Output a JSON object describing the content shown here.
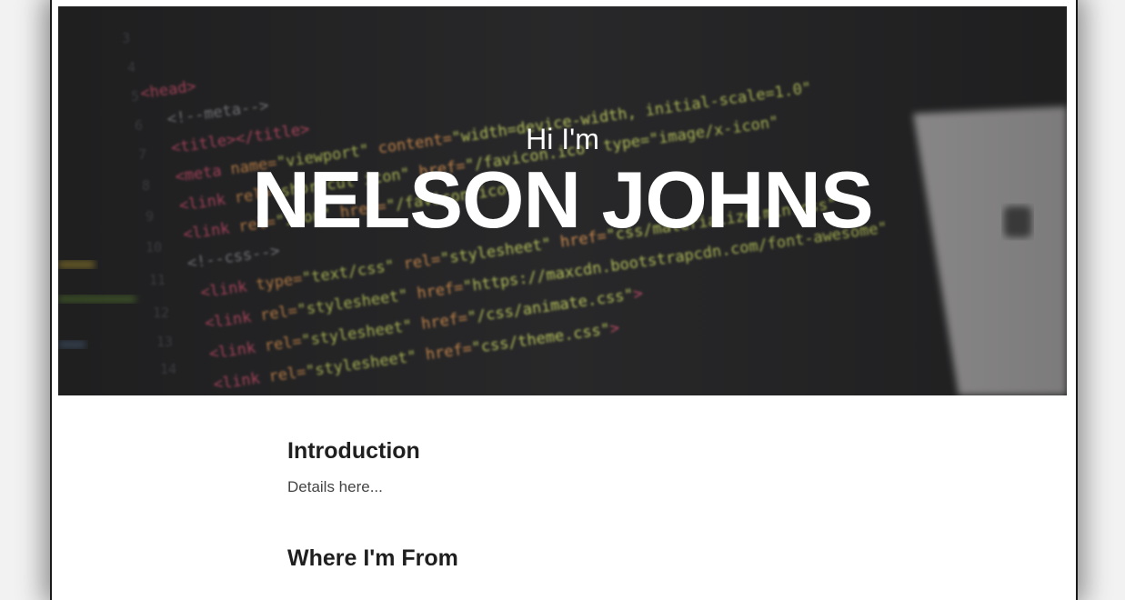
{
  "hero": {
    "greeting": "Hi I'm",
    "name": "NELSON JOHNS",
    "background": "blurred code editor photo"
  },
  "sections": [
    {
      "title": "Introduction",
      "body": "Details here..."
    },
    {
      "title": "Where I'm From",
      "body": ""
    }
  ],
  "colors": {
    "page_background": "#f2f2f2",
    "content_background": "#ffffff",
    "hero_overlay": "#2e2e30",
    "heading_text": "#1f1f1f",
    "body_text": "#444444",
    "hero_text": "#ffffff"
  }
}
